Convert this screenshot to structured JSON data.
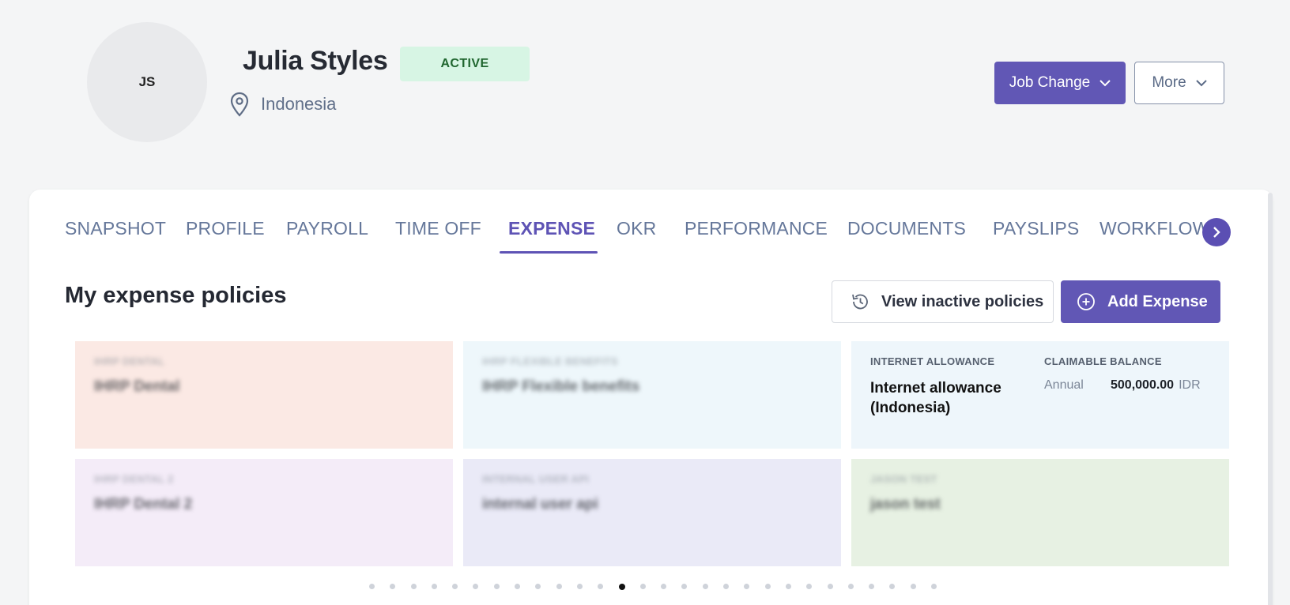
{
  "employee": {
    "initials": "JS",
    "name": "Julia Styles",
    "status": "ACTIVE",
    "location": "Indonesia"
  },
  "header_actions": {
    "job_change": "Job Change",
    "more": "More"
  },
  "tabs": [
    {
      "label": "SNAPSHOT"
    },
    {
      "label": "PROFILE"
    },
    {
      "label": "PAYROLL"
    },
    {
      "label": "TIME OFF"
    },
    {
      "label": "EXPENSE",
      "active": true
    },
    {
      "label": "OKR"
    },
    {
      "label": "PERFORMANCE"
    },
    {
      "label": "DOCUMENTS"
    },
    {
      "label": "PAYSLIPS"
    },
    {
      "label": "WORKFLOW"
    }
  ],
  "section": {
    "title": "My expense policies",
    "view_inactive": "View inactive policies",
    "add_expense": "Add Expense"
  },
  "policies": [
    {
      "category": "IHRP DENTAL",
      "name": "IHRP Dental",
      "color": "#fbe9e4"
    },
    {
      "category": "IHRP FLEXIBLE BENEFITS",
      "name": "IHRP Flexible benefits",
      "color": "#eef7fb"
    },
    {
      "category": "INTERNET ALLOWANCE",
      "name": "Internet allowance (Indonesia)",
      "balance_label": "CLAIMABLE BALANCE",
      "period": "Annual",
      "amount": "500,000.00",
      "currency": "IDR",
      "color": "#eef6fb"
    },
    {
      "category": "IHRP DENTAL 2",
      "name": "IHRP Dental 2",
      "color": "#f4ecf8"
    },
    {
      "category": "INTERNAL USER API",
      "name": "internal user api",
      "color": "#eaeaf7"
    },
    {
      "category": "JASON TEST",
      "name": "jason test",
      "color": "#e7f1e3"
    }
  ],
  "pagination": {
    "total": 28,
    "active_index": 12
  },
  "colors": {
    "primary": "#6157b5",
    "active_badge_bg": "#d7f5e4",
    "active_badge_text": "#20662f"
  },
  "icons": [
    "location-pin-icon",
    "chevron-down-icon",
    "chevron-right-icon",
    "history-icon",
    "plus-circle-icon"
  ]
}
